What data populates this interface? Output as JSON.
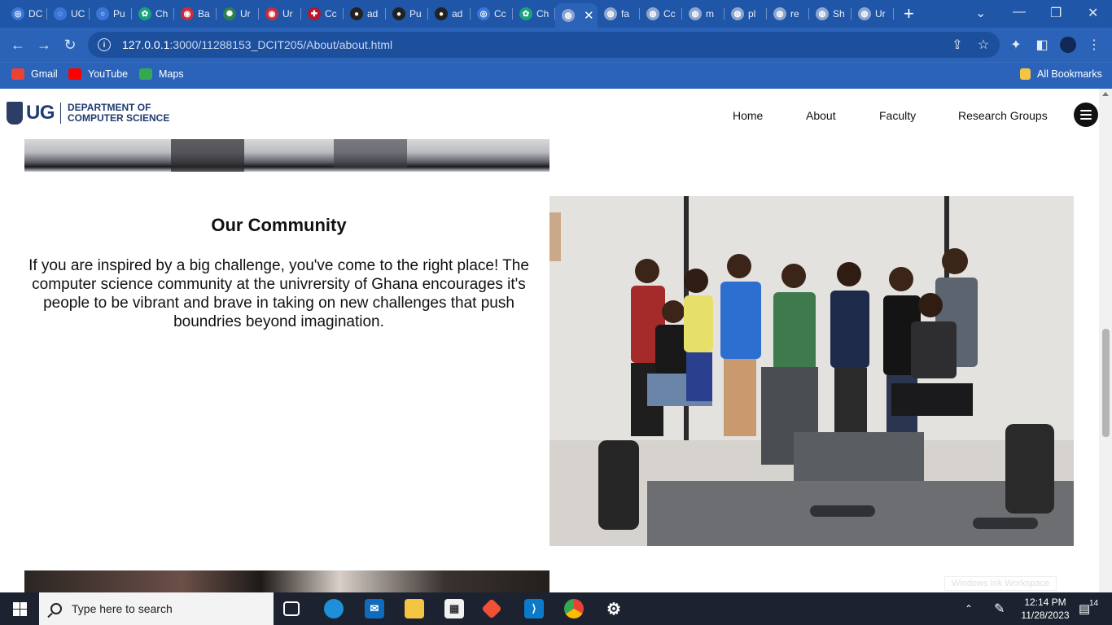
{
  "browser": {
    "tabs": [
      {
        "label": "DC",
        "color": "#3a76d8",
        "glyph": "◎"
      },
      {
        "label": "UC",
        "color": "#3a76d8",
        "glyph": "◌"
      },
      {
        "label": "Pu",
        "color": "#3a76d8",
        "glyph": "○"
      },
      {
        "label": "Ch",
        "color": "#1aa37a",
        "glyph": "✿"
      },
      {
        "label": "Ba",
        "color": "#c92d3b",
        "glyph": "◉"
      },
      {
        "label": "Ur",
        "color": "#2f7f4f",
        "glyph": "✺"
      },
      {
        "label": "Ur",
        "color": "#c92d3b",
        "glyph": "◉"
      },
      {
        "label": "Cc",
        "color": "#b9152b",
        "glyph": "✚"
      },
      {
        "label": "ad",
        "color": "#222222",
        "glyph": "●"
      },
      {
        "label": "Pu",
        "color": "#222222",
        "glyph": "●"
      },
      {
        "label": "ad",
        "color": "#222222",
        "glyph": "●"
      },
      {
        "label": "Cc",
        "color": "#3a76d8",
        "glyph": "◎"
      },
      {
        "label": "Ch",
        "color": "#1aa37a",
        "glyph": "✿"
      },
      {
        "label": "",
        "color": "#8ea6cf",
        "glyph": "◍",
        "active": true
      },
      {
        "label": "fa",
        "color": "#8ea6cf",
        "glyph": "◍"
      },
      {
        "label": "Cc",
        "color": "#8ea6cf",
        "glyph": "◍"
      },
      {
        "label": "m",
        "color": "#8ea6cf",
        "glyph": "◍"
      },
      {
        "label": "pl",
        "color": "#8ea6cf",
        "glyph": "◍"
      },
      {
        "label": "re",
        "color": "#8ea6cf",
        "glyph": "◍"
      },
      {
        "label": "Sh",
        "color": "#8ea6cf",
        "glyph": "◍"
      },
      {
        "label": "Ur",
        "color": "#8ea6cf",
        "glyph": "◍"
      }
    ],
    "close_tab_glyph": "✕",
    "new_tab_glyph": "+",
    "url_host": "127.0.0.1",
    "url_path": ":3000/11288153_DCIT205/About/about.html",
    "bookmarks": [
      {
        "label": "Gmail",
        "color": "#ea4335"
      },
      {
        "label": "YouTube",
        "color": "#ff0000"
      },
      {
        "label": "Maps",
        "color": "#34a853"
      }
    ],
    "all_bookmarks": "All Bookmarks"
  },
  "site": {
    "logo_ug": "UG",
    "logo_dept_line1": "DEPARTMENT OF",
    "logo_dept_line2": "COMPUTER SCIENCE",
    "nav": [
      "Home",
      "About",
      "Faculty",
      "Research Groups"
    ]
  },
  "community": {
    "title": "Our Community",
    "text": "If you are inspired by a big challenge, you've come to the right place! The computer science community at the univrersity of Ghana encourages it's people to be vibrant and brave in taking on new challenges that push boundries beyond imagination."
  },
  "overlay": {
    "watermark": "Windows Ink Workspace"
  },
  "taskbar": {
    "search_placeholder": "Type here to search",
    "time": "12:14 PM",
    "date": "11/28/2023",
    "notification_count": "14"
  }
}
